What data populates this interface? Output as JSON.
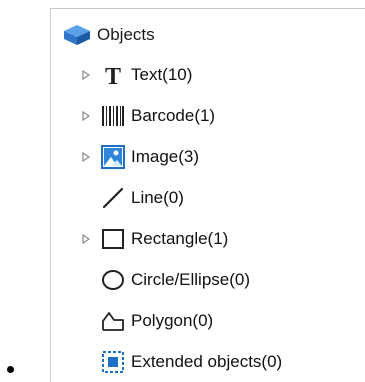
{
  "tree": {
    "header": {
      "label": "Objects",
      "icon": "cube-icon"
    },
    "items": [
      {
        "label": "Text(10)",
        "icon": "text-icon",
        "expandable": true
      },
      {
        "label": "Barcode(1)",
        "icon": "barcode-icon",
        "expandable": true
      },
      {
        "label": "Image(3)",
        "icon": "image-icon",
        "expandable": true
      },
      {
        "label": "Line(0)",
        "icon": "line-icon",
        "expandable": false
      },
      {
        "label": "Rectangle(1)",
        "icon": "rectangle-icon",
        "expandable": true
      },
      {
        "label": "Circle/Ellipse(0)",
        "icon": "ellipse-icon",
        "expandable": false
      },
      {
        "label": "Polygon(0)",
        "icon": "polygon-icon",
        "expandable": false
      },
      {
        "label": "Extended objects(0)",
        "icon": "extended-objects-icon",
        "expandable": false
      }
    ]
  },
  "colors": {
    "accent": "#1e6fc8",
    "expander": "#8a8a8a",
    "panel_border": "#c8c8c8"
  }
}
